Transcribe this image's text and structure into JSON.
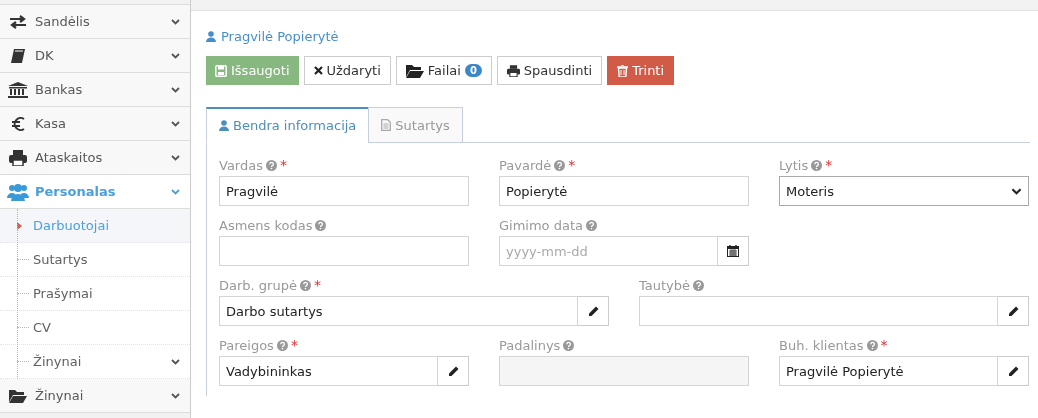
{
  "sidebar": {
    "items": [
      {
        "label": "Sandėlis",
        "expanded": false,
        "selected": false
      },
      {
        "label": "DK",
        "expanded": false,
        "selected": false
      },
      {
        "label": "Bankas",
        "expanded": false,
        "selected": false
      },
      {
        "label": "Kasa",
        "expanded": false,
        "selected": false
      },
      {
        "label": "Ataskaitos",
        "expanded": false,
        "selected": false
      },
      {
        "label": "Personalas",
        "expanded": true,
        "selected": false,
        "children": [
          {
            "label": "Darbuotojai",
            "selected": true
          },
          {
            "label": "Sutartys",
            "selected": false
          },
          {
            "label": "Prašymai",
            "selected": false
          },
          {
            "label": "CV",
            "selected": false
          },
          {
            "label": "Žinynai",
            "selected": false,
            "expanded": false
          }
        ]
      },
      {
        "label": "Žinynai",
        "expanded": false,
        "selected": false
      }
    ]
  },
  "page": {
    "title": "Pragvilė Popierytė"
  },
  "toolbar": [
    {
      "kind": "save",
      "label": "Išsaugoti"
    },
    {
      "kind": "close",
      "label": "Uždaryti"
    },
    {
      "kind": "files",
      "label": "Failai",
      "badge": "0"
    },
    {
      "kind": "print",
      "label": "Spausdinti"
    },
    {
      "kind": "delete",
      "label": "Trinti"
    }
  ],
  "tabs": [
    {
      "label": "Bendra informacija",
      "selected": true
    },
    {
      "label": "Sutartys",
      "selected": false
    }
  ],
  "form": {
    "rows": [
      [
        {
          "label": "Vardas",
          "required_mark": "*",
          "kind": "text",
          "value": "Pragvilė"
        },
        {
          "label": "Pavardė",
          "required_mark": "*",
          "kind": "text",
          "value": "Popierytė"
        },
        {
          "label": "Lytis",
          "required_mark": "*",
          "kind": "select",
          "value": "Moteris"
        }
      ],
      [
        {
          "label": "Asmens kodas",
          "kind": "text"
        },
        {
          "label": "Gimimo data",
          "kind": "date",
          "placeholder": "yyyy-mm-dd"
        },
        {
          "kind": "empty"
        }
      ],
      [
        {
          "label": "Darb. grupė",
          "required_mark": "*",
          "kind": "lookup",
          "value": "Darbo sutartys"
        },
        {
          "label": "Tautybė",
          "kind": "lookup"
        }
      ],
      [
        {
          "label": "Pareigos",
          "required_mark": "*",
          "kind": "lookup",
          "value": "Vadybininkas"
        },
        {
          "label": "Padalinys",
          "kind": "disabled"
        },
        {
          "label": "Buh. klientas",
          "required_mark": "*",
          "kind": "lookup",
          "value": "Pragvilė Popierytė"
        }
      ]
    ]
  }
}
